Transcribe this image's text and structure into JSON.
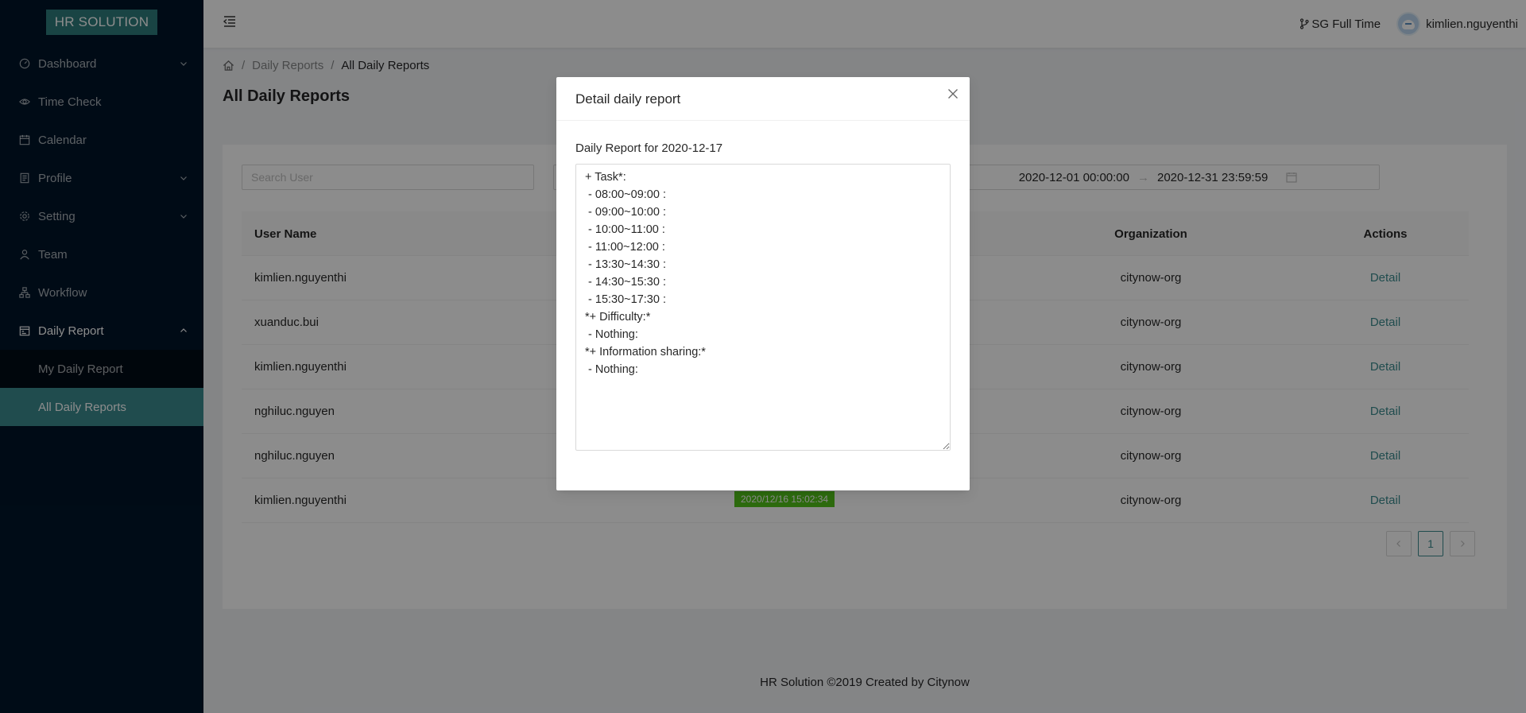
{
  "app": {
    "logo": "HR SOLUTION"
  },
  "sidebar": {
    "items": [
      {
        "label": "Dashboard",
        "icon": "dashboard-icon",
        "has_caret": true
      },
      {
        "label": "Time Check",
        "icon": "eye-icon",
        "has_caret": false
      },
      {
        "label": "Calendar",
        "icon": "calendar-icon",
        "has_caret": false
      },
      {
        "label": "Profile",
        "icon": "profile-icon",
        "has_caret": true
      },
      {
        "label": "Setting",
        "icon": "gear-icon",
        "has_caret": true
      },
      {
        "label": "Team",
        "icon": "team-icon",
        "has_caret": false
      },
      {
        "label": "Workflow",
        "icon": "workflow-icon",
        "has_caret": false
      },
      {
        "label": "Daily Report",
        "icon": "schedule-icon",
        "has_caret": true,
        "open": true
      }
    ],
    "subitems": [
      {
        "label": "My Daily Report",
        "active": false
      },
      {
        "label": "All Daily Reports",
        "active": true
      }
    ]
  },
  "header": {
    "branch": "SG Full Time",
    "username": "kimlien.nguyenthi"
  },
  "breadcrumb": {
    "parent": "Daily Reports",
    "current": "All Daily Reports"
  },
  "page": {
    "title": "All Daily Reports"
  },
  "filters": {
    "search_placeholder": "Search User",
    "range_start": "2020-12-01 00:00:00",
    "range_end": "2020-12-31 23:59:59"
  },
  "table": {
    "headers": {
      "user": "User Name",
      "organization": "Organization",
      "actions": "Actions"
    },
    "rows": [
      {
        "user": "kimlien.nguyenthi",
        "org": "citynow-org",
        "action": "Detail",
        "date": ""
      },
      {
        "user": "xuanduc.bui",
        "org": "citynow-org",
        "action": "Detail",
        "date": ""
      },
      {
        "user": "kimlien.nguyenthi",
        "org": "citynow-org",
        "action": "Detail",
        "date": ""
      },
      {
        "user": "nghiluc.nguyen",
        "org": "citynow-org",
        "action": "Detail",
        "date": ""
      },
      {
        "user": "nghiluc.nguyen",
        "org": "citynow-org",
        "action": "Detail",
        "date": ""
      },
      {
        "user": "kimlien.nguyenthi",
        "org": "citynow-org",
        "action": "Detail",
        "date": "2020/12/16 15:02:34"
      }
    ]
  },
  "pagination": {
    "current": "1"
  },
  "footer": {
    "text": "HR Solution ©2019 Created by Citynow"
  },
  "modal": {
    "title": "Detail daily report",
    "label": "Daily Report for 2020-12-17",
    "content": "+ Task*:\n - 08:00~09:00 :\n - 09:00~10:00 :\n - 10:00~11:00 :\n - 11:00~12:00 :\n - 13:30~14:30 :\n - 14:30~15:30 :\n - 15:30~17:30 :\n*+ Difficulty:*\n - Nothing:\n*+ Information sharing:*\n - Nothing:"
  },
  "colors": {
    "sidebar_bg": "#001529",
    "accent": "#3b8b8f",
    "tag_green": "#52c41a"
  }
}
